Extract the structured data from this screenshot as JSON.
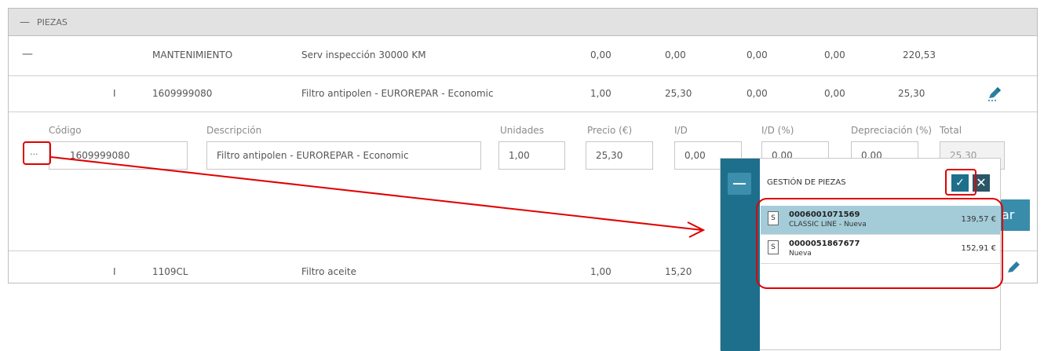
{
  "section": {
    "toggle": "—",
    "title": "PIEZAS"
  },
  "group_row": {
    "toggle": "—",
    "type": "MANTENIMIENTO",
    "description": "Serv inspección 30000 KM",
    "units": "0,00",
    "price": "0,00",
    "discount": "0,00",
    "discount_pct": "0,00",
    "total": "220,53"
  },
  "part_row_1": {
    "marker": "I",
    "code": "1609999080",
    "description": "Filtro antipolen - EUROREPAR - Economic",
    "units": "1,00",
    "price": "25,30",
    "discount": "0,00",
    "discount_pct": "0,00",
    "total": "25,30"
  },
  "edit_form": {
    "labels": {
      "code": "Código",
      "description": "Descripción",
      "units": "Unidades",
      "price": "Precio (€)",
      "discount": "I/D",
      "discount_pct": "I/D (%)",
      "depreciation": "Depreciación (%)",
      "total": "Total"
    },
    "browse_button": "···",
    "values": {
      "code": "1609999080",
      "description": "Filtro antipolen - EUROREPAR - Economic",
      "units": "1,00",
      "price": "25,30",
      "discount": "0,00",
      "discount_pct": "0,00",
      "depreciation": "0,00",
      "total": "25,30"
    },
    "side_button_partial": "ar"
  },
  "part_row_2": {
    "marker": "I",
    "code": "1109CL",
    "description": "Filtro aceite",
    "units": "1,00",
    "price": "15,20"
  },
  "popup": {
    "title": "GESTIÓN DE PIEZAS",
    "confirm_icon": "check-icon",
    "close_icon": "close-icon",
    "items": [
      {
        "badge": "S",
        "code": "0006001071569",
        "description": "CLASSIC LINE - Nueva",
        "price": "139,57 €",
        "selected": true
      },
      {
        "badge": "S",
        "code": "0000051867677",
        "description": "Nueva",
        "price": "152,91 €",
        "selected": false
      }
    ]
  },
  "colors": {
    "accent": "#1d6f8b",
    "selected_row": "#a4ccd8",
    "annotation": "#e00000",
    "header_bg": "#e2e2e2"
  }
}
